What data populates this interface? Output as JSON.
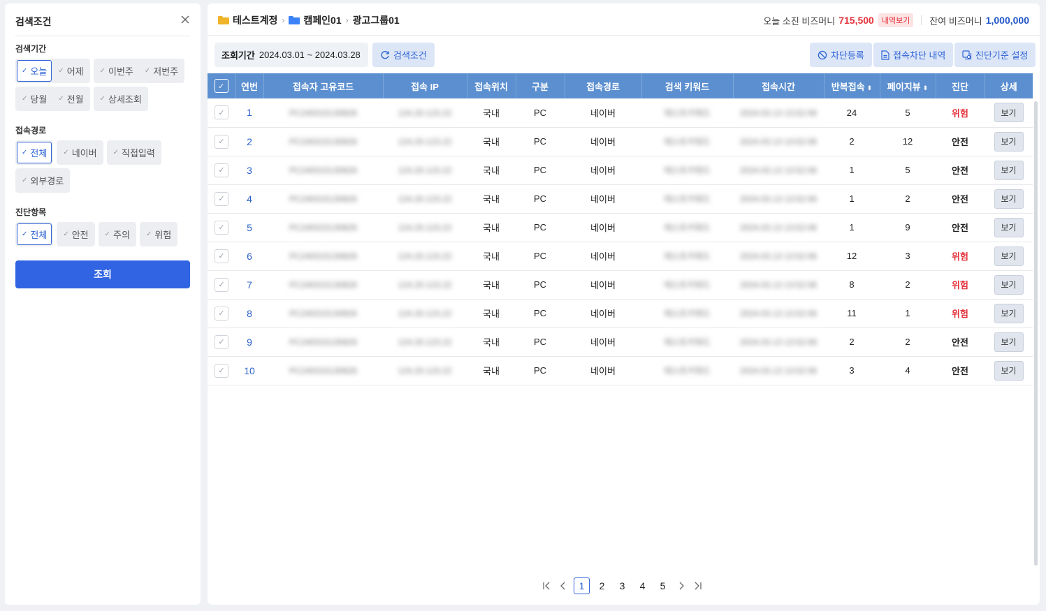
{
  "sidebar": {
    "title": "검색조건",
    "sections": [
      {
        "label": "검색기간",
        "options": [
          [
            "오늘",
            "어제"
          ],
          [
            "이번주",
            "저번주"
          ],
          [
            "당월",
            "전월"
          ],
          [
            "상세조회"
          ]
        ],
        "selected": "오늘"
      },
      {
        "label": "접속경로",
        "options": [
          [
            "전체"
          ],
          [
            "네이버"
          ],
          [
            "직접입력"
          ],
          [
            "외부경로"
          ]
        ],
        "selected": "전체"
      },
      {
        "label": "진단항목",
        "options": [
          [
            "전체"
          ],
          [
            "안전"
          ],
          [
            "주의"
          ],
          [
            "위험"
          ]
        ],
        "selected": "전체"
      }
    ],
    "query_label": "조회"
  },
  "breadcrumb": [
    "테스트계정",
    "캠페인01",
    "광고그룹01"
  ],
  "money": {
    "today_label": "오늘 소진 비즈머니",
    "today_value": "715,500",
    "history_label": "내역보기",
    "balance_label": "잔여 비즈머니",
    "balance_value": "1,000,000"
  },
  "period": {
    "label": "조회기간",
    "value": "2024.03.01 ~ 2024.03.28"
  },
  "buttons": {
    "search_conditions": "검색조건",
    "block_register": "차단등록",
    "block_history": "접속차단 내역",
    "diag_settings": "진단기준 설정"
  },
  "table": {
    "columns": [
      "연번",
      "접속자 고유코드",
      "접속 IP",
      "접속위치",
      "구분",
      "접속경로",
      "검색 키워드",
      "접속시간",
      "반복접속",
      "페이지뷰",
      "진단",
      "상세"
    ],
    "blurred": {
      "code": "PC240315130826",
      "ip": "124.20.123.22",
      "keyword": "테스트키워드",
      "time": "2024.03.13 13:52:06"
    },
    "view_label": "보기",
    "rows": [
      {
        "no": "1",
        "loc": "국내",
        "type": "PC",
        "route": "네이버",
        "repeat": "24",
        "pv": "5",
        "diag": "위험"
      },
      {
        "no": "2",
        "loc": "국내",
        "type": "PC",
        "route": "네이버",
        "repeat": "2",
        "pv": "12",
        "diag": "안전"
      },
      {
        "no": "3",
        "loc": "국내",
        "type": "PC",
        "route": "네이버",
        "repeat": "1",
        "pv": "5",
        "diag": "안전"
      },
      {
        "no": "4",
        "loc": "국내",
        "type": "PC",
        "route": "네이버",
        "repeat": "1",
        "pv": "2",
        "diag": "안전"
      },
      {
        "no": "5",
        "loc": "국내",
        "type": "PC",
        "route": "네이버",
        "repeat": "1",
        "pv": "9",
        "diag": "안전"
      },
      {
        "no": "6",
        "loc": "국내",
        "type": "PC",
        "route": "네이버",
        "repeat": "12",
        "pv": "3",
        "diag": "위험"
      },
      {
        "no": "7",
        "loc": "국내",
        "type": "PC",
        "route": "네이버",
        "repeat": "8",
        "pv": "2",
        "diag": "위험"
      },
      {
        "no": "8",
        "loc": "국내",
        "type": "PC",
        "route": "네이버",
        "repeat": "11",
        "pv": "1",
        "diag": "위험"
      },
      {
        "no": "9",
        "loc": "국내",
        "type": "PC",
        "route": "네이버",
        "repeat": "2",
        "pv": "2",
        "diag": "안전"
      },
      {
        "no": "10",
        "loc": "국내",
        "type": "PC",
        "route": "네이버",
        "repeat": "3",
        "pv": "4",
        "diag": "안전"
      }
    ]
  },
  "pagination": {
    "pages": [
      "1",
      "2",
      "3",
      "4",
      "5"
    ],
    "current": "1"
  },
  "colors": {
    "accent": "#3064e3",
    "header": "#5b8fd0",
    "danger": "#e5323b"
  }
}
